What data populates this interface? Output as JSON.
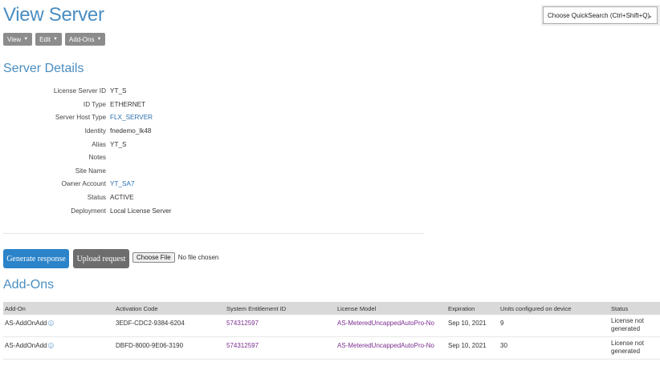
{
  "page": {
    "title": "View Server"
  },
  "quicksearch": {
    "label": "Choose QuickSearch (Ctrl+Shift+Q)"
  },
  "menu": [
    {
      "label": "View"
    },
    {
      "label": "Edit"
    },
    {
      "label": "Add-Ons"
    }
  ],
  "server_details": {
    "title": "Server Details",
    "fields": [
      {
        "label": "License Server ID",
        "value": "YT_S",
        "link": false
      },
      {
        "label": "ID Type",
        "value": "ETHERNET",
        "link": false
      },
      {
        "label": "Server Host Type",
        "value": "FLX_SERVER",
        "link": true
      },
      {
        "label": "Identity",
        "value": "fnedemo_lk48",
        "link": false
      },
      {
        "label": "Alias",
        "value": "YT_S",
        "link": false
      },
      {
        "label": "Notes",
        "value": "",
        "link": false
      },
      {
        "label": "Site Name",
        "value": "",
        "link": false
      },
      {
        "label": "Owner Account",
        "value": "YT_SA7",
        "link": true
      },
      {
        "label": "Status",
        "value": "ACTIVE",
        "link": false
      },
      {
        "label": "Deployment",
        "value": "Local License Server",
        "link": false
      }
    ]
  },
  "actions": {
    "generate_response": "Generate response",
    "upload_request": "Upload request",
    "choose_file": "Choose File",
    "no_file": "No file chosen"
  },
  "addons": {
    "title": "Add-Ons",
    "columns": [
      "Add-On",
      "Activation Code",
      "System Entitlement ID",
      "License Model",
      "Expiration",
      "Units configured on device",
      "Status"
    ],
    "rows": [
      {
        "addon": "AS-AddOnAdd",
        "activation_code": "3EDF-CDC2-9384-6204",
        "entitlement_id": "574312597",
        "license_model": "AS-MeteredUncappedAutoPro-No",
        "expiration": "Sep 10, 2021",
        "units": "9",
        "status": "License not generated"
      },
      {
        "addon": "AS-AddOnAdd",
        "activation_code": "DBFD-8000-9E06-3190",
        "entitlement_id": "574312597",
        "license_model": "AS-MeteredUncappedAutoPro-No",
        "expiration": "Sep 10, 2021",
        "units": "30",
        "status": "License not generated"
      }
    ]
  },
  "colors": {
    "accent": "#4a8ec2",
    "primary_button": "#2b83c9",
    "secondary_button": "#6d6d6d",
    "link_purple": "#7b2d8e"
  }
}
